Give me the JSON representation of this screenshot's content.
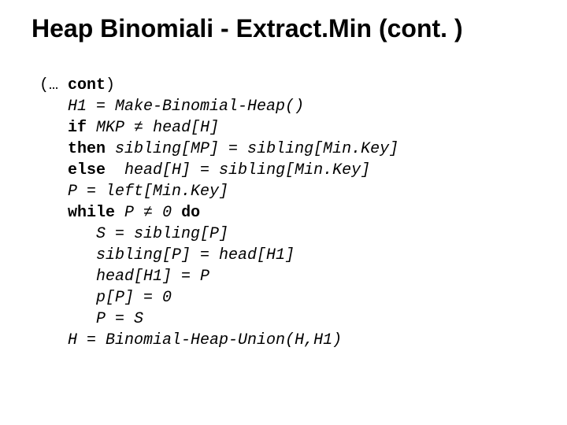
{
  "title": "Heap Binomiali - Extract.Min (cont. )",
  "code": {
    "cont_open": "(… ",
    "cont_kw": "cont",
    "cont_close": ")",
    "l1_it": "H1 = Make-Binomial-Heap()",
    "l2_kw": "if",
    "l2_it_a": " MKP ",
    "l2_ne": "≠",
    "l2_it_b": " head[H]",
    "l3_kw": "then",
    "l3_it": " sibling[MP] = sibling[Min.Key]",
    "l4_kw": "else",
    "l4_it": "  head[H] = sibling[Min.Key]",
    "l5_it": "P = left[Min.Key]",
    "l6_kw_while": "while",
    "l6_it_a": " P ",
    "l6_ne": "≠",
    "l6_it_b": " 0 ",
    "l6_kw_do": "do",
    "l7_it": "S = sibling[P]",
    "l8_it": "sibling[P] = head[H1]",
    "l9_it": "head[H1] = P",
    "l10_it": "p[P] = 0",
    "l11_it": "P = S",
    "l12_it": "H = Binomial-Heap-Union(H,H1)"
  }
}
